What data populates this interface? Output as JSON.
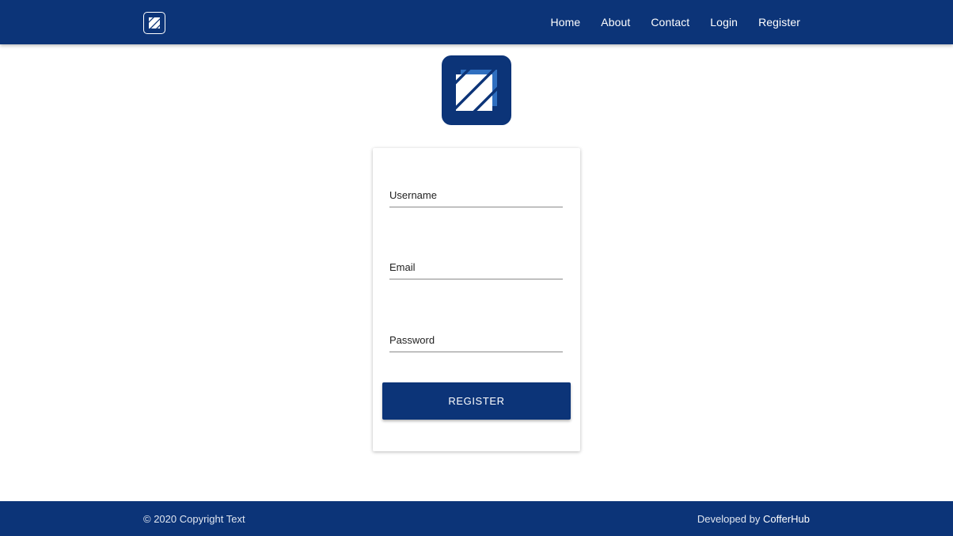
{
  "colors": {
    "primary": "#0c3478",
    "background": "#ffffff",
    "text_on_primary": "#ffffff"
  },
  "header": {
    "logo_icon": "diagonal-stripes-logo-icon",
    "nav": [
      {
        "label": "Home"
      },
      {
        "label": "About"
      },
      {
        "label": "Contact"
      },
      {
        "label": "Login"
      },
      {
        "label": "Register"
      }
    ]
  },
  "main": {
    "logo_icon": "diagonal-stripes-logo-icon",
    "form": {
      "username_placeholder": "Username",
      "email_placeholder": "Email",
      "password_placeholder": "Password",
      "submit_label": "REGISTER"
    }
  },
  "footer": {
    "copyright": "© 2020 Copyright Text",
    "developed_by_prefix": "Developed by ",
    "developer_name": "CofferHub"
  }
}
